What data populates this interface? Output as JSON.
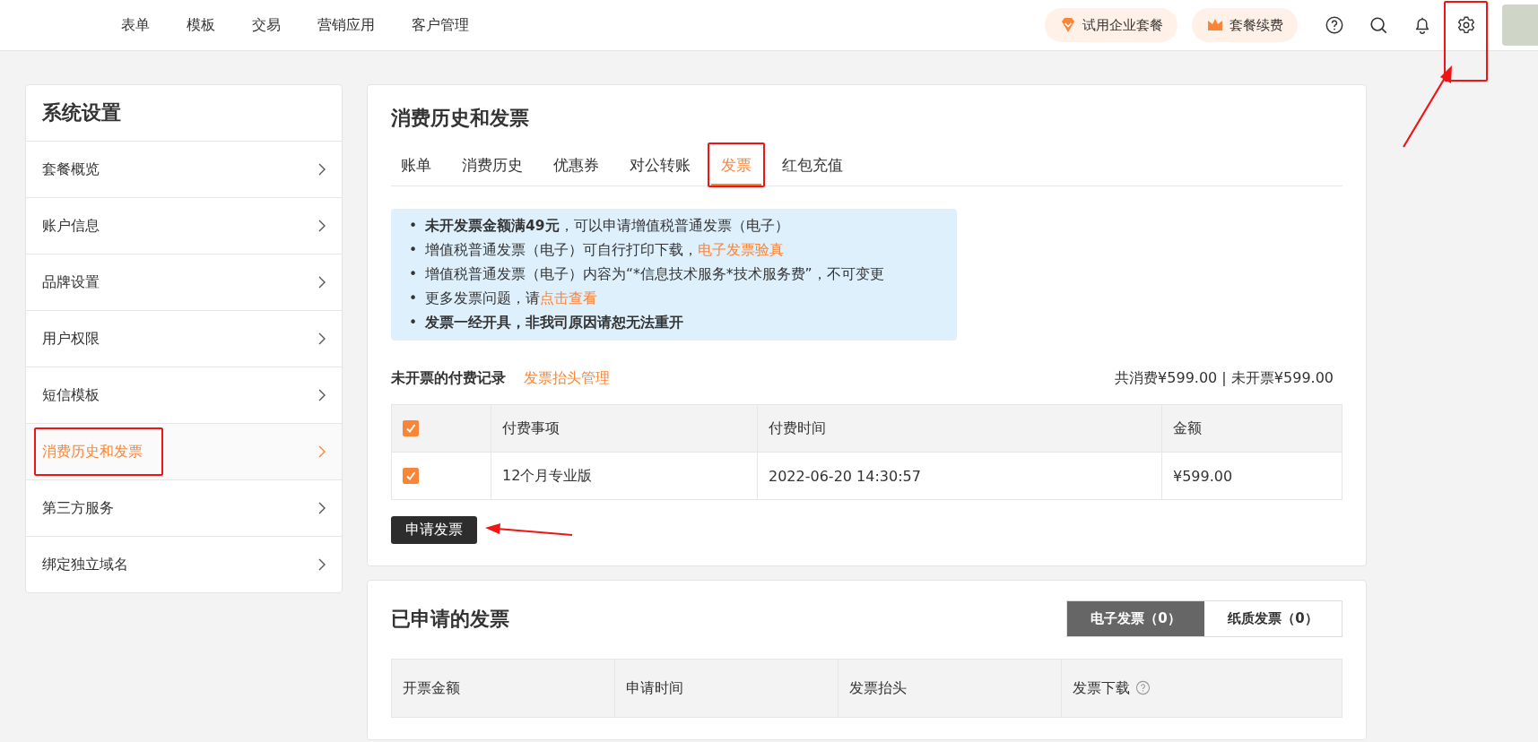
{
  "top_nav": {
    "items": [
      "表单",
      "模板",
      "交易",
      "营销应用",
      "客户管理"
    ],
    "trial_button": "试用企业套餐",
    "renew_button": "套餐续费",
    "icons": [
      {
        "kind": "help",
        "highlighted": false
      },
      {
        "kind": "search",
        "highlighted": false
      },
      {
        "kind": "bell",
        "highlighted": false
      },
      {
        "kind": "settings",
        "highlighted": true
      }
    ]
  },
  "sidebar": {
    "title": "系统设置",
    "items": [
      {
        "label": "套餐概览",
        "selected": false,
        "highlighted": false
      },
      {
        "label": "账户信息",
        "selected": false,
        "highlighted": false
      },
      {
        "label": "品牌设置",
        "selected": false,
        "highlighted": false
      },
      {
        "label": "用户权限",
        "selected": false,
        "highlighted": false
      },
      {
        "label": "短信模板",
        "selected": false,
        "highlighted": false
      },
      {
        "label": "消费历史和发票",
        "selected": true,
        "highlighted": true
      },
      {
        "label": "第三方服务",
        "selected": false,
        "highlighted": false
      },
      {
        "label": "绑定独立域名",
        "selected": false,
        "highlighted": false
      }
    ]
  },
  "billing_card": {
    "title": "消费历史和发票",
    "tabs": [
      {
        "label": "账单",
        "selected": false,
        "highlighted": false
      },
      {
        "label": "消费历史",
        "selected": false,
        "highlighted": false
      },
      {
        "label": "优惠券",
        "selected": false,
        "highlighted": false
      },
      {
        "label": "对公转账",
        "selected": false,
        "highlighted": false
      },
      {
        "label": "发票",
        "selected": true,
        "highlighted": true
      },
      {
        "label": "红包充值",
        "selected": false,
        "highlighted": false
      }
    ],
    "notice": [
      {
        "bullet": "•",
        "text": "**未开发票金额满49元**，可以申请增值税普通发票（电子）",
        "bold": false
      },
      {
        "bullet": "•",
        "text": "增值税普通发票（电子）可自行打印下载，",
        "link": "电子发票验真",
        "bold": false
      },
      {
        "bullet": "•",
        "text": "增值税普通发票（电子）内容为“*信息技术服务*技术服务费”，不可变更",
        "bold": false
      },
      {
        "bullet": "•",
        "text": "更多发票问题，请",
        "link": "点击查看",
        "bold": false
      },
      {
        "bullet": "•",
        "text": "发票一经开具，非我司原因请恕无法重开",
        "bold": true
      }
    ],
    "unbilled_title": "未开票的付费记录",
    "title_link": "发票抬头管理",
    "summary": "共消费¥599.00 | 未开票¥599.00",
    "table": {
      "header_checked": true,
      "columns": [
        "付费事项",
        "付费时间",
        "金额"
      ],
      "rows": [
        {
          "checked": true,
          "cells": [
            "12个月专业版",
            "2022-06-20 14:30:57",
            "¥599.00"
          ]
        }
      ]
    },
    "apply_button": {
      "label": "申请发票",
      "arrow": true
    }
  },
  "applied_card": {
    "title": "已申请的发票",
    "toggle": [
      {
        "label": "电子发票（0）",
        "selected": true
      },
      {
        "label": "纸质发票（0）",
        "selected": false
      }
    ],
    "columns": [
      {
        "label": "开票金额",
        "help": false
      },
      {
        "label": "申请时间",
        "help": false
      },
      {
        "label": "发票抬头",
        "help": false
      },
      {
        "label": "发票下载",
        "help": true
      }
    ]
  }
}
